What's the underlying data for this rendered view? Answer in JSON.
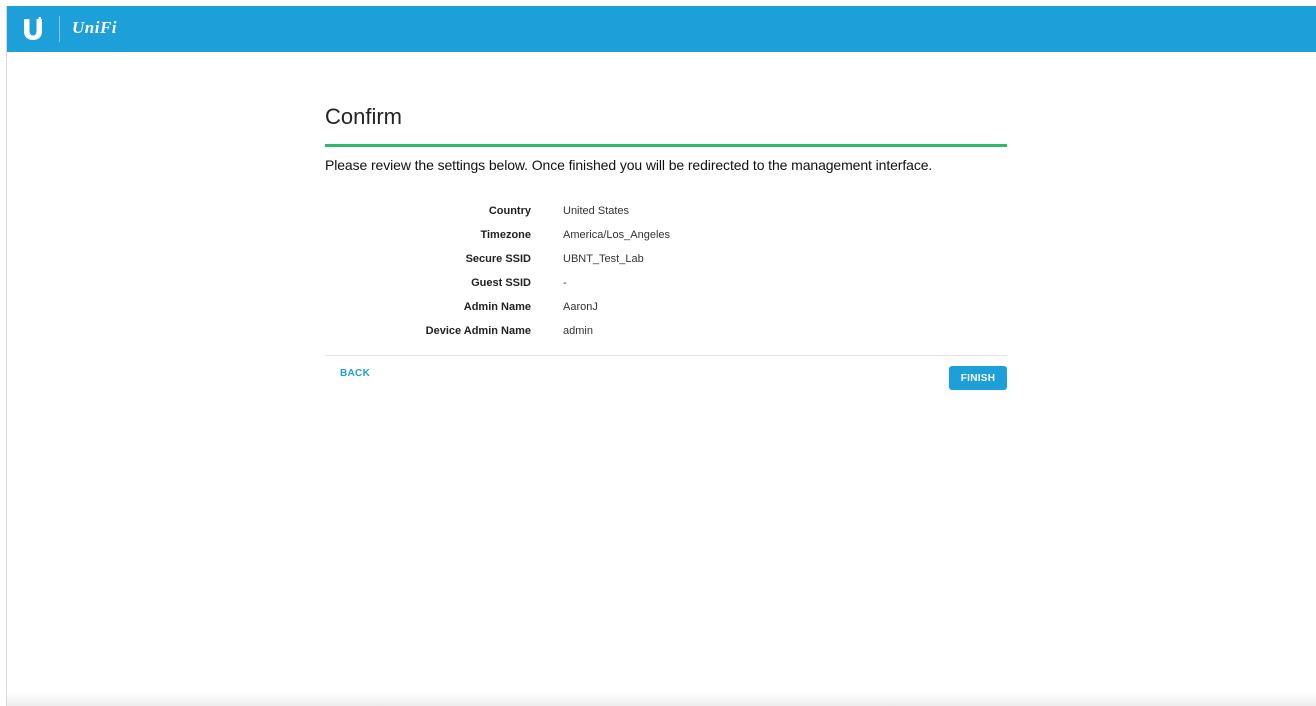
{
  "header": {
    "logo_icon": "ubiquiti-u-logo-icon",
    "brand_text": "UniFi",
    "bar_color": "#1d9fd9"
  },
  "main": {
    "title": "Confirm",
    "accent_color": "#2eb872",
    "intro": "Please review the settings below. Once finished you will be redirected to the management interface.",
    "settings": [
      {
        "label": "Country",
        "value": "United States"
      },
      {
        "label": "Timezone",
        "value": "America/Los_Angeles"
      },
      {
        "label": "Secure SSID",
        "value": "UBNT_Test_Lab"
      },
      {
        "label": "Guest SSID",
        "value": "-"
      },
      {
        "label": "Admin Name",
        "value": "AaronJ"
      },
      {
        "label": "Device Admin Name",
        "value": "admin"
      }
    ]
  },
  "actions": {
    "back_label": "BACK",
    "finish_label": "FINISH"
  }
}
